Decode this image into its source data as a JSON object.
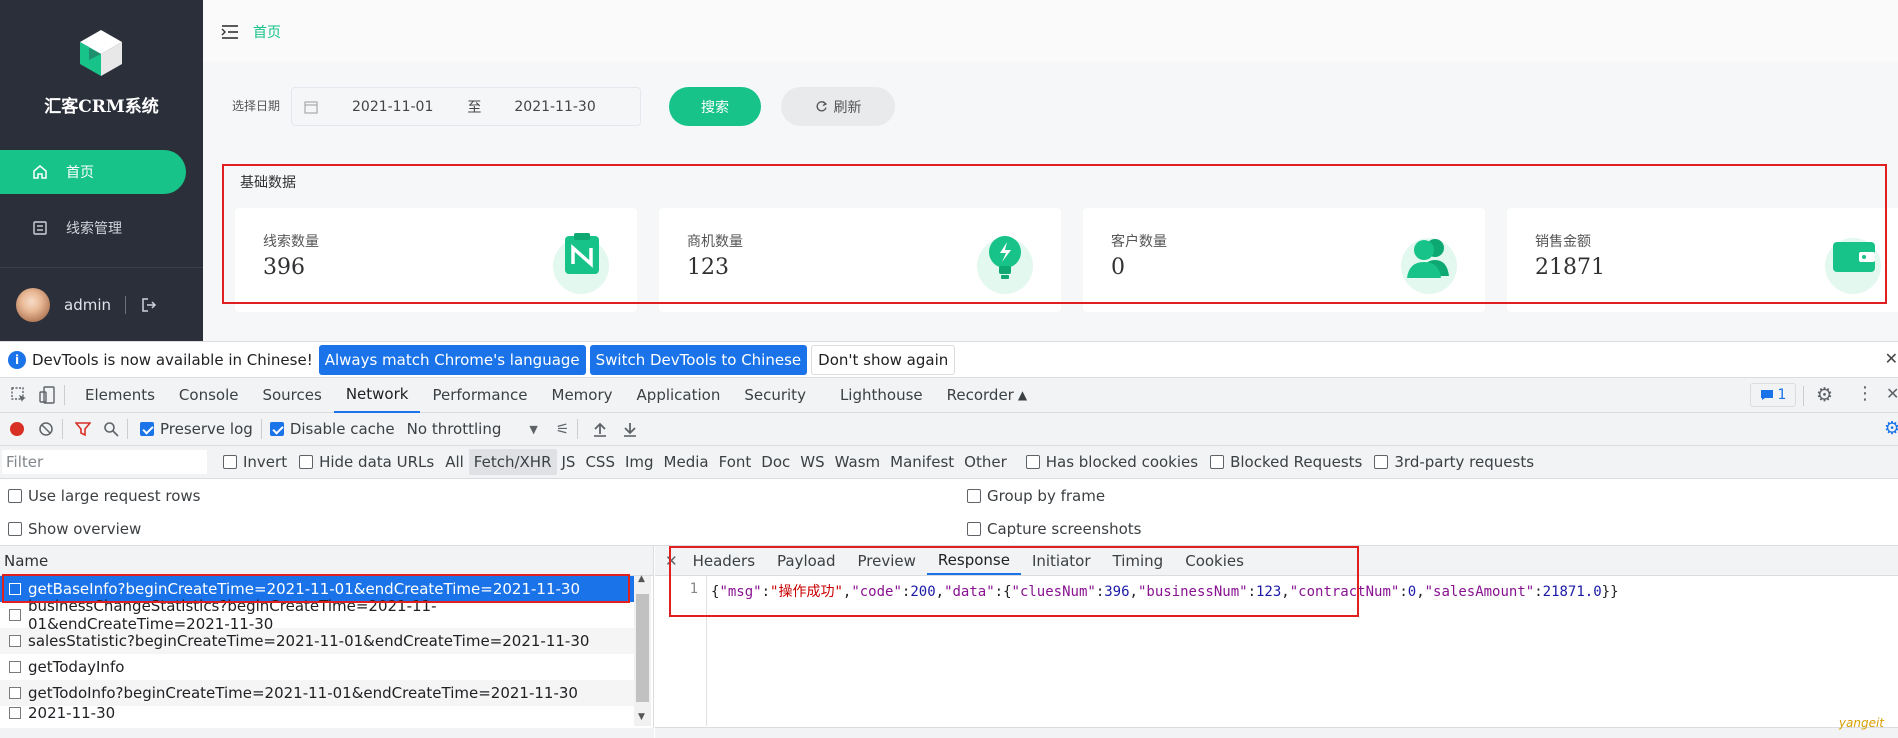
{
  "app": {
    "title": "汇客CRM系统",
    "menu": [
      {
        "label": "首页",
        "icon": "home-icon",
        "active": true
      },
      {
        "label": "线索管理",
        "icon": "clues-icon",
        "active": false
      }
    ],
    "user": {
      "name": "admin"
    },
    "breadcrumb": "首页",
    "filter": {
      "label": "选择日期",
      "start": "2021-11-01",
      "separator": "至",
      "end": "2021-11-30",
      "search_label": "搜索",
      "refresh_label": "刷新"
    },
    "stats": {
      "title": "基础数据",
      "cards": [
        {
          "label": "线索数量",
          "value": "396",
          "icon": "clipboard-icon"
        },
        {
          "label": "商机数量",
          "value": "123",
          "icon": "lightbulb-icon"
        },
        {
          "label": "客户数量",
          "value": "0",
          "icon": "users-icon"
        },
        {
          "label": "销售金额",
          "value": "21871",
          "icon": "wallet-icon"
        }
      ]
    },
    "accent": "#17c389"
  },
  "devtools": {
    "infobar": {
      "message": "DevTools is now available in Chinese!",
      "btn_match": "Always match Chrome's language",
      "btn_switch": "Switch DevTools to Chinese",
      "btn_dismiss": "Don't show again"
    },
    "tabs": [
      "Elements",
      "Console",
      "Sources",
      "Network",
      "Performance",
      "Memory",
      "Application",
      "Security",
      "Lighthouse",
      "Recorder"
    ],
    "active_tab": "Network",
    "issues_count": "1",
    "toolbar": {
      "preserve_log": "Preserve log",
      "disable_cache": "Disable cache",
      "throttling": "No throttling"
    },
    "filter_bar": {
      "placeholder": "Filter",
      "invert": "Invert",
      "hide_data_urls": "Hide data URLs",
      "types": [
        "All",
        "Fetch/XHR",
        "JS",
        "CSS",
        "Img",
        "Media",
        "Font",
        "Doc",
        "WS",
        "Wasm",
        "Manifest",
        "Other"
      ],
      "active_type": "Fetch/XHR",
      "blocked_cookies": "Has blocked cookies",
      "blocked_requests": "Blocked Requests",
      "third_party": "3rd-party requests"
    },
    "options": {
      "large_rows": "Use large request rows",
      "show_overview": "Show overview",
      "group_by_frame": "Group by frame",
      "capture_screenshots": "Capture screenshots"
    },
    "requests": {
      "header": "Name",
      "rows": [
        "getBaseInfo?beginCreateTime=2021-11-01&endCreateTime=2021-11-30",
        "businessChangeStatistics?beginCreateTime=2021-11-01&endCreateTime=2021-11-30",
        "salesStatistic?beginCreateTime=2021-11-01&endCreateTime=2021-11-30",
        "getTodayInfo",
        "getTodoInfo?beginCreateTime=2021-11-01&endCreateTime=2021-11-30",
        "2021-11-30"
      ],
      "selected_index": 0
    },
    "detail": {
      "tabs": [
        "Headers",
        "Payload",
        "Preview",
        "Response",
        "Initiator",
        "Timing",
        "Cookies"
      ],
      "active_tab": "Response",
      "line_number": "1",
      "response": {
        "p1": "{",
        "k_msg": "\"msg\"",
        "c1": ":",
        "v_msg": "\"操作成功\"",
        "p2": ",",
        "k_code": "\"code\"",
        "c2": ":",
        "v_code": "200",
        "p3": ",",
        "k_data": "\"data\"",
        "c3": ":{",
        "k_clues": "\"cluesNum\"",
        "c4": ":",
        "v_clues": "396",
        "p4": ",",
        "k_business": "\"businessNum\"",
        "c5": ":",
        "v_business": "123",
        "p5": ",",
        "k_contract": "\"contractNum\"",
        "c6": ":",
        "v_contract": "0",
        "p6": ",",
        "k_sales": "\"salesAmount\"",
        "c7": ":",
        "v_sales": "21871.0",
        "p7": "}}"
      }
    },
    "watermark": "yangeit"
  }
}
